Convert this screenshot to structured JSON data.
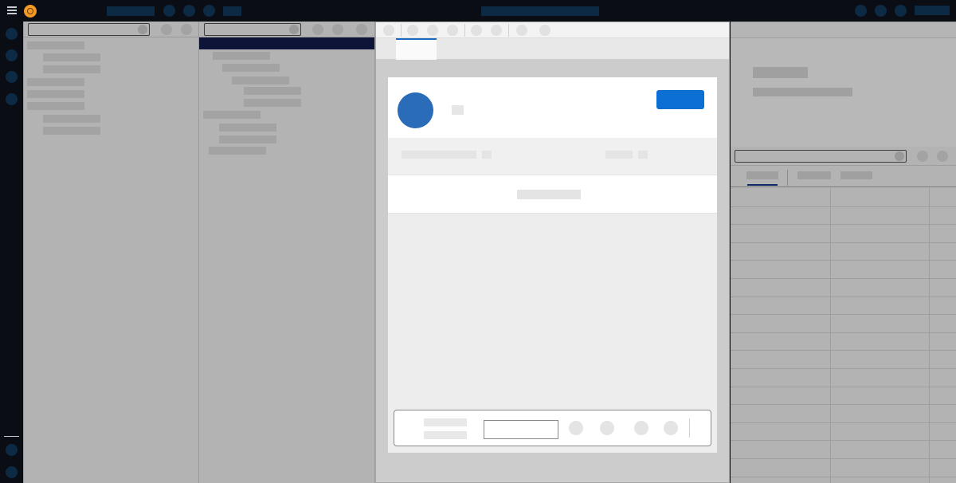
{
  "topbar": {
    "menu_icon": "hamburger-icon",
    "logo_icon": "app-logo-icon",
    "brand_color": "#f09a2a",
    "right_actions": [
      "bell-icon",
      "help-icon",
      "avatar-icon"
    ]
  },
  "rail": {
    "icons": [
      "home-icon",
      "search-icon",
      "files-icon",
      "settings-icon"
    ],
    "bottom_icons": [
      "user-icon",
      "logout-icon"
    ]
  },
  "main": {
    "accent": "#1a6bbf",
    "primary_button_color": "#0b6fd3",
    "avatar_color": "#2a6cb8"
  },
  "right": {
    "grid_rows": 16,
    "grid_cols": 3
  }
}
